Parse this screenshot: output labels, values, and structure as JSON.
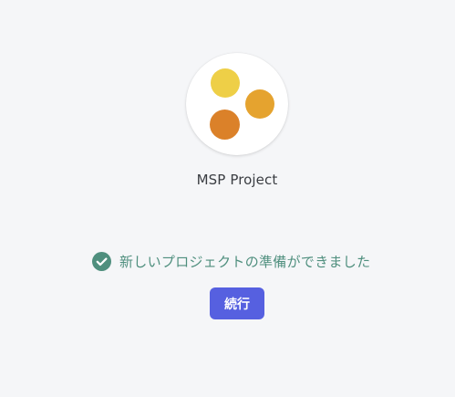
{
  "project": {
    "name": "MSP Project",
    "logo_dot_colors": [
      "#eecf47",
      "#e5a32f",
      "#db8129"
    ]
  },
  "status": {
    "icon": "check-circle-icon",
    "message": "新しいプロジェクトの準備ができました",
    "color": "#4f8f7e"
  },
  "actions": {
    "continue_label": "続行",
    "continue_color": "#5660e0"
  }
}
